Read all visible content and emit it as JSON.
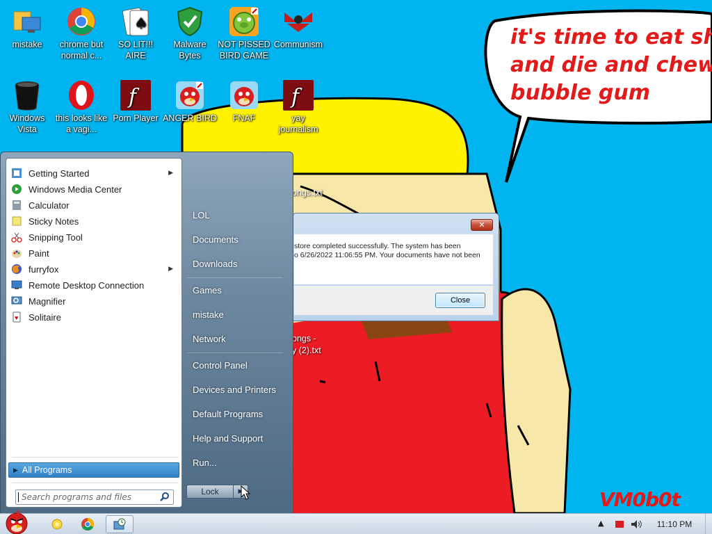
{
  "desktop": {
    "icons": [
      {
        "label": "mistake",
        "icon": "folder-monitor-icon"
      },
      {
        "label": "chrome but normal c...",
        "icon": "chrome-icon"
      },
      {
        "label": "SO LIT!!! AIRE",
        "icon": "solitaire-icon"
      },
      {
        "label": "Malware Bytes",
        "icon": "shield-check-icon"
      },
      {
        "label": "NOT PISSED BIRD GAME",
        "icon": "green-pig-icon"
      },
      {
        "label": "Communism",
        "icon": "communism-emblem-icon"
      },
      {
        "label": "Windows Vista",
        "icon": "trash-bin-icon"
      },
      {
        "label": "this looks like a vagi...",
        "icon": "opera-icon"
      },
      {
        "label": "Porn Player",
        "icon": "flash-icon"
      },
      {
        "label": "ANGER BIRD",
        "icon": "angry-bird-icon"
      },
      {
        "label": "FNAF",
        "icon": "angry-bird-icon"
      },
      {
        "label": "yay journalism",
        "icon": "flash-icon"
      }
    ],
    "files": [
      {
        "label": "ongs.txt"
      },
      {
        "label": "ongs -"
      },
      {
        "label": "y (2).txt"
      }
    ]
  },
  "wallpaper": {
    "speech_text": "it's time to eat shit\nand die and chew\nbubble gum",
    "watermark": "VM0b0t",
    "colors": {
      "sky": "#00b4ef",
      "hat": "#fff200",
      "shirt": "#ed1c24",
      "skin": "#f7e7a8",
      "hair": "#8b4513"
    }
  },
  "dialog": {
    "line1": "store completed successfully. The system has been",
    "line2": "o 6/26/2022 11:06:55 PM. Your documents have not been",
    "close_button": "Close",
    "close_x": "✕"
  },
  "start_menu": {
    "programs": [
      {
        "label": "Getting Started",
        "icon": "getting-started-icon",
        "submenu": true
      },
      {
        "label": "Windows Media Center",
        "icon": "media-center-icon",
        "submenu": false
      },
      {
        "label": "Calculator",
        "icon": "calculator-icon",
        "submenu": false
      },
      {
        "label": "Sticky Notes",
        "icon": "sticky-notes-icon",
        "submenu": false
      },
      {
        "label": "Snipping Tool",
        "icon": "snipping-tool-icon",
        "submenu": false
      },
      {
        "label": "Paint",
        "icon": "paint-icon",
        "submenu": false
      },
      {
        "label": "furryfox",
        "icon": "firefox-icon",
        "submenu": true
      },
      {
        "label": "Remote Desktop Connection",
        "icon": "remote-desktop-icon",
        "submenu": false
      },
      {
        "label": "Magnifier",
        "icon": "magnifier-icon",
        "submenu": false
      },
      {
        "label": "Solitaire",
        "icon": "solitaire-icon",
        "submenu": false
      }
    ],
    "all_programs": "All Programs",
    "search_placeholder": "Search programs and files",
    "right_items": [
      {
        "label": "LOL"
      },
      {
        "label": "Documents"
      },
      {
        "label": "Downloads"
      },
      {
        "label": "Games"
      },
      {
        "label": "mistake"
      },
      {
        "label": "Network"
      },
      {
        "label": "Control Panel"
      },
      {
        "label": "Devices and Printers"
      },
      {
        "label": "Default Programs"
      },
      {
        "label": "Help and Support"
      },
      {
        "label": "Run..."
      }
    ],
    "lock_label": "Lock",
    "lock_arrow": "▶"
  },
  "taskbar": {
    "start_icon": "angry-bird-start-icon",
    "pinned": [
      {
        "icon": "sticky-notes-icon"
      },
      {
        "icon": "chrome-icon"
      },
      {
        "icon": "system-restore-icon"
      }
    ],
    "tray_expand": "▲",
    "clock": "11:10 PM"
  }
}
